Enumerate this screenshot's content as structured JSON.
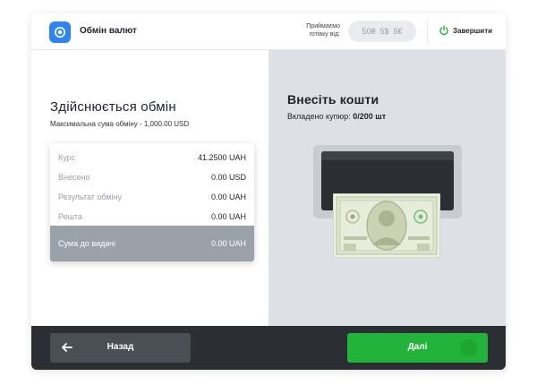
{
  "header": {
    "app_title": "Обмін валют",
    "accept_label_line1": "Приймаємо",
    "accept_label_line2": "готівку від:",
    "denominations": [
      "50₴",
      "5$",
      "5€"
    ],
    "finish_label": "Завершити"
  },
  "exchange": {
    "title": "Здійснюється обмін",
    "max_sum_text": "Максимальна сума обміну - 1,000.00 USD",
    "rows": [
      {
        "label": "Курс",
        "value": "41.2500 UAH"
      },
      {
        "label": "Внесено",
        "value": "0.00 USD"
      },
      {
        "label": "Результат обміну",
        "value": "0.00 UAH"
      },
      {
        "label": "Решта",
        "value": "0.00 UAH"
      }
    ],
    "total": {
      "label": "Сума до видачі",
      "value": "0.00 UAH"
    }
  },
  "insert": {
    "title": "Внесіть кошти",
    "inserted_label": "Вкладено купюр:",
    "inserted_value": "0/200 шт"
  },
  "footer": {
    "back_label": "Назад",
    "next_label": "Далі"
  },
  "colors": {
    "accent_blue": "#2f86f2",
    "success_green": "#22b33a",
    "footer_dark": "#2b2f33",
    "panel_gray": "#dde1e5"
  }
}
